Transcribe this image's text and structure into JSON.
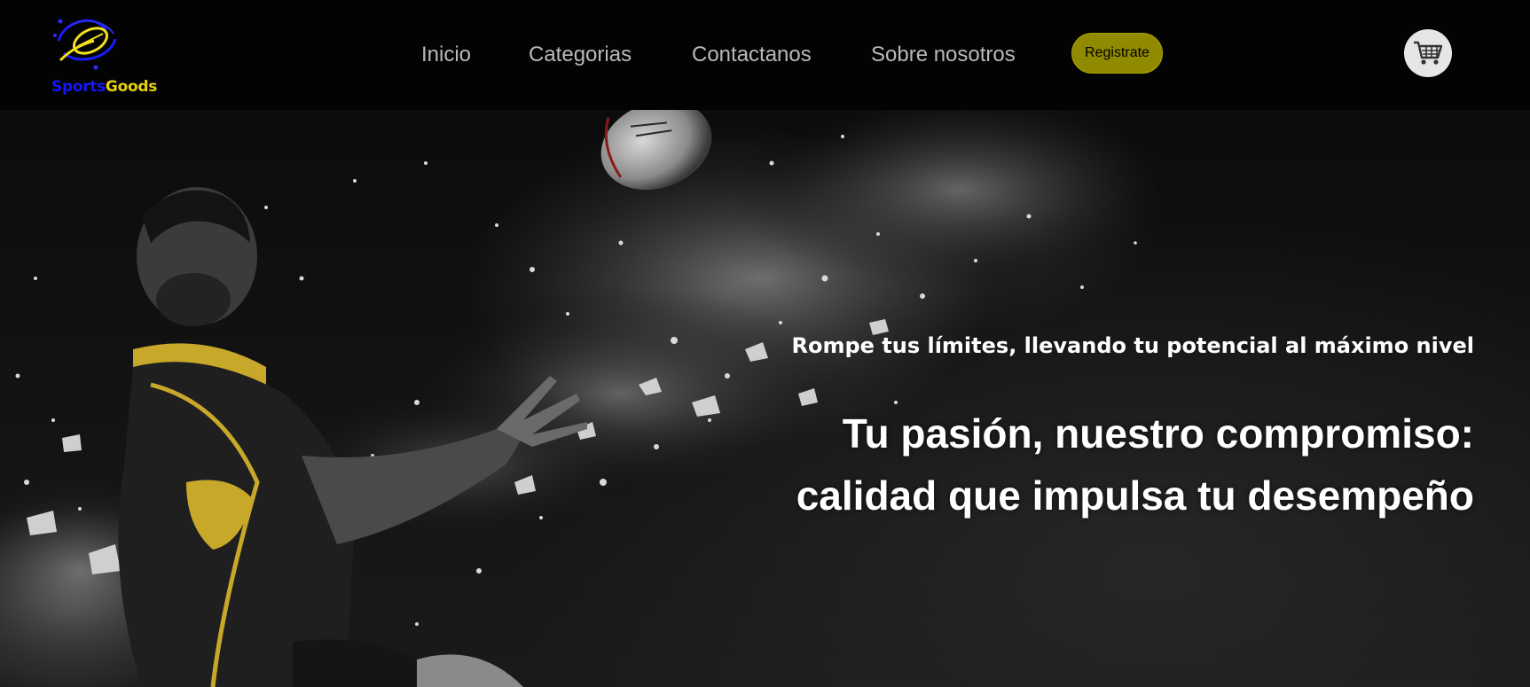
{
  "brand": {
    "name_part1": "Sports",
    "name_part2": "Goods",
    "color_part1": "#1515ff",
    "color_part2": "#e8d20f",
    "logo_icon": "rugby-ball-swoosh-icon"
  },
  "nav": {
    "links": [
      {
        "label": "Inicio"
      },
      {
        "label": "Categorias"
      },
      {
        "label": "Contactanos"
      },
      {
        "label": "Sobre nosotros"
      }
    ],
    "register_label": "Registrate",
    "register_color": "#8f8a00",
    "cart_icon": "shopping-cart-icon"
  },
  "hero": {
    "subtitle": "Rompe tus límites, llevando tu potencial al máximo nivel",
    "title_line1": "Tu pasión, nuestro compromiso:",
    "title_line2": "calidad que impulsa tu desempeño",
    "image": "rugby-player-catching-ball-black-white"
  }
}
